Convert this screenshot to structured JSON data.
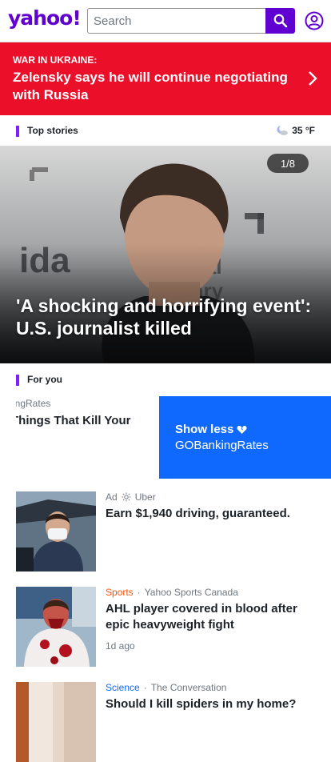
{
  "header": {
    "logo": "yahoo!",
    "search_placeholder": "Search"
  },
  "alert": {
    "kicker": "WAR IN UKRAINE:",
    "headline": "Zelensky says he will continue negotiating with Russia"
  },
  "top_stories": {
    "label": "Top stories",
    "weather_temp": "35 °F",
    "weather_icon": "partly-cloudy-night-icon"
  },
  "hero": {
    "counter": "1/8",
    "headline": "'A shocking and horrifying event': U.S. journalist killed"
  },
  "for_you": {
    "label": "For you",
    "card_left": {
      "source": "cingRates",
      "title": "Things That Kill Your"
    },
    "card_blue": {
      "show_less": "Show less",
      "source": "GOBankingRates"
    }
  },
  "stories": [
    {
      "ad_label": "Ad",
      "source": "Uber",
      "title": "Earn $1,940 driving, guaranteed.",
      "time": ""
    },
    {
      "category": "Sports",
      "category_color": "#ff520d",
      "source": "Yahoo Sports Canada",
      "title": "AHL player covered in blood after epic heavyweight fight",
      "time": "1d ago"
    },
    {
      "category": "Science",
      "category_color": "#0f69ff",
      "source": "The Conversation",
      "title": "Should I kill spiders in my home?",
      "time": ""
    }
  ],
  "colors": {
    "brand": "#6001d2",
    "alert": "#eb0f29",
    "accent_blue": "#0f69ff"
  }
}
